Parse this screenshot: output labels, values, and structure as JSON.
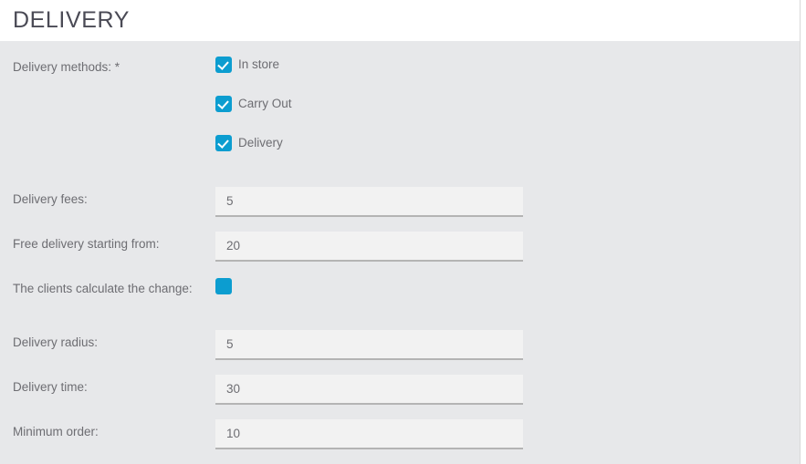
{
  "header": {
    "title": "DELIVERY"
  },
  "form": {
    "delivery_methods": {
      "label": "Delivery methods: *",
      "options": [
        {
          "label": "In store",
          "checked": true
        },
        {
          "label": "Carry Out",
          "checked": true
        },
        {
          "label": "Delivery",
          "checked": true
        }
      ]
    },
    "delivery_fees": {
      "label": "Delivery fees:",
      "value": "5",
      "placeholder": ""
    },
    "free_delivery_from": {
      "label": "Free delivery starting from:",
      "value": "20",
      "placeholder": ""
    },
    "clients_calculate_change": {
      "label": "The clients calculate the change:",
      "checked": false
    },
    "delivery_radius": {
      "label": "Delivery radius:",
      "value": "5",
      "placeholder": ""
    },
    "delivery_time": {
      "label": "Delivery time:",
      "value": "30",
      "placeholder": ""
    },
    "minimum_order": {
      "label": "Minimum order:",
      "value": "10",
      "placeholder": ""
    }
  },
  "colors": {
    "accent": "#0c9dd0",
    "panel_background": "#e7e8ea",
    "input_background": "#f2f2f2",
    "input_underline": "#b4b4b4",
    "label_text": "#6d6d72",
    "title_text": "#4a4a55"
  }
}
